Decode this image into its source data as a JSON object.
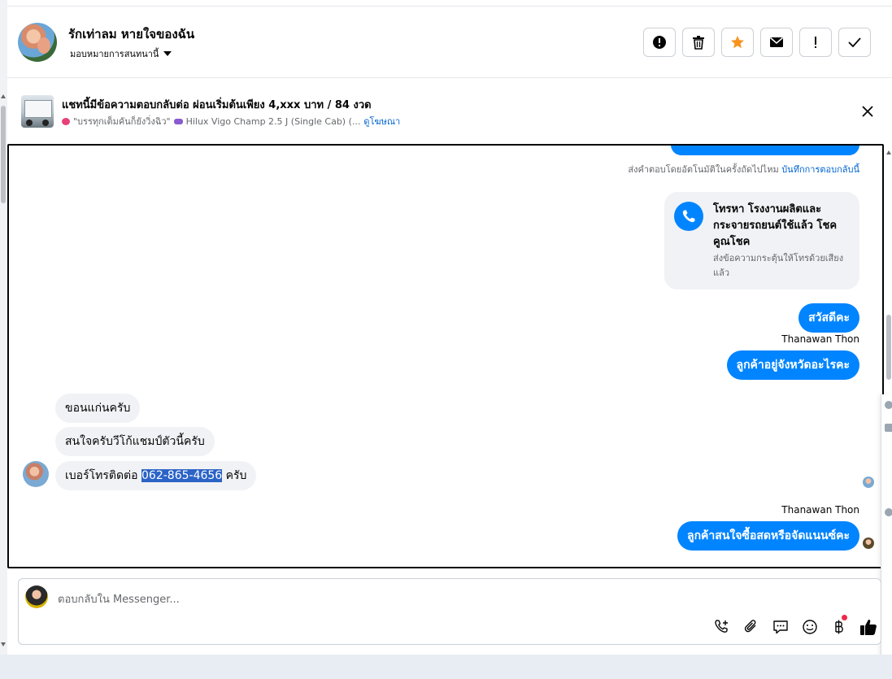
{
  "header": {
    "contact_name": "รักเท่าลม หายใจของฉัน",
    "assign_label": "มอบหมายการสนทนานี้"
  },
  "toolbar": {
    "buttons": [
      {
        "icon": "alert-circle-icon"
      },
      {
        "icon": "trash-icon"
      },
      {
        "icon": "star-icon",
        "color": "#f7931e"
      },
      {
        "icon": "envelope-icon"
      },
      {
        "icon": "exclamation-icon"
      },
      {
        "icon": "checkmark-icon"
      }
    ]
  },
  "ad_banner": {
    "title": "แชทนี้มีข้อความตอบกลับต่อ ผ่อนเริ่มต้นเพียง 4,xxx บาท / 84 งวด",
    "subtitle_part1": "\"บรรทุกเต็มคันก็ยังวิ่งฉิว\"",
    "subtitle_part2": "Hilux Vigo Champ 2.5 J (Single Cab) (...",
    "view_ad_link": "ดูโฆษณา"
  },
  "chat": {
    "auto_reply_prompt": "ส่งคำตอบโดยอัตโนมัติในครั้งถัดไปไหม",
    "auto_reply_link": "บันทึกการตอบกลับนี้",
    "call_card": {
      "title": "โทรหา โรงงานผลิตและกระจายรถยนต์ใช้แล้ว โชคคูณโชค",
      "subtitle": "ส่งข้อความกระตุ้นให้โทรด้วยเสียงแล้ว"
    },
    "messages": [
      {
        "direction": "out",
        "text": "สวัสดีคะ"
      },
      {
        "direction": "out",
        "sender": "Thanawan Thon",
        "text": "ลูกค้าอยู่จังหวัดอะไรคะ"
      },
      {
        "direction": "in",
        "text": "ขอนแก่นครับ"
      },
      {
        "direction": "in",
        "text": "สนใจครับวีโก้แชมป์ตัวนี้ครับ"
      },
      {
        "direction": "in",
        "text_before": "เบอร์โทรติดต่อ ",
        "phone": "062-865-4656",
        "text_after": " ครับ"
      },
      {
        "direction": "out",
        "sender": "Thanawan Thon",
        "text": "ลูกค้าสนใจซื้อสดหรือจัดแนนซ์คะ"
      }
    ]
  },
  "composer": {
    "placeholder": "ตอบกลับใน Messenger...",
    "icons": [
      "phone-plus-icon",
      "paperclip-icon",
      "chat-bubble-icon",
      "emoji-icon",
      "baht-icon",
      "thumbs-up-icon"
    ],
    "accent": "#0084ff"
  }
}
